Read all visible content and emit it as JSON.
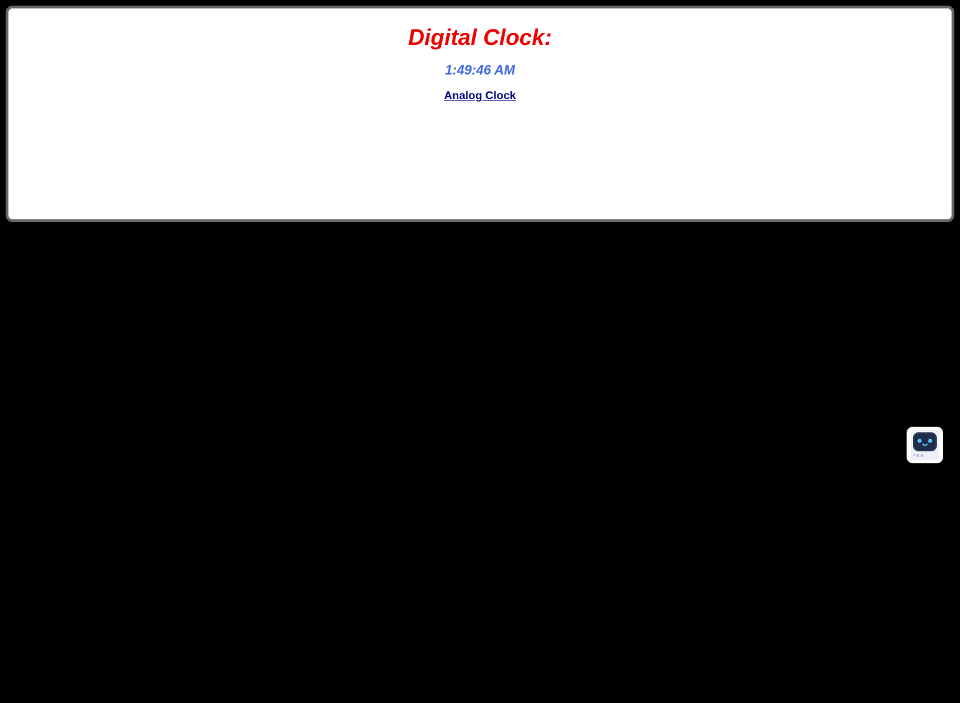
{
  "clock": {
    "title": "Digital Clock:",
    "time": "1:49:46 AM",
    "link_label": "Analog Clock"
  },
  "assistant": {
    "icon": "robot-icon"
  },
  "colors": {
    "background": "#000000",
    "panel": "#ffffff",
    "panel_border": "#666666",
    "title": "#ee0000",
    "time": "#4169e1",
    "link": "#000080"
  }
}
